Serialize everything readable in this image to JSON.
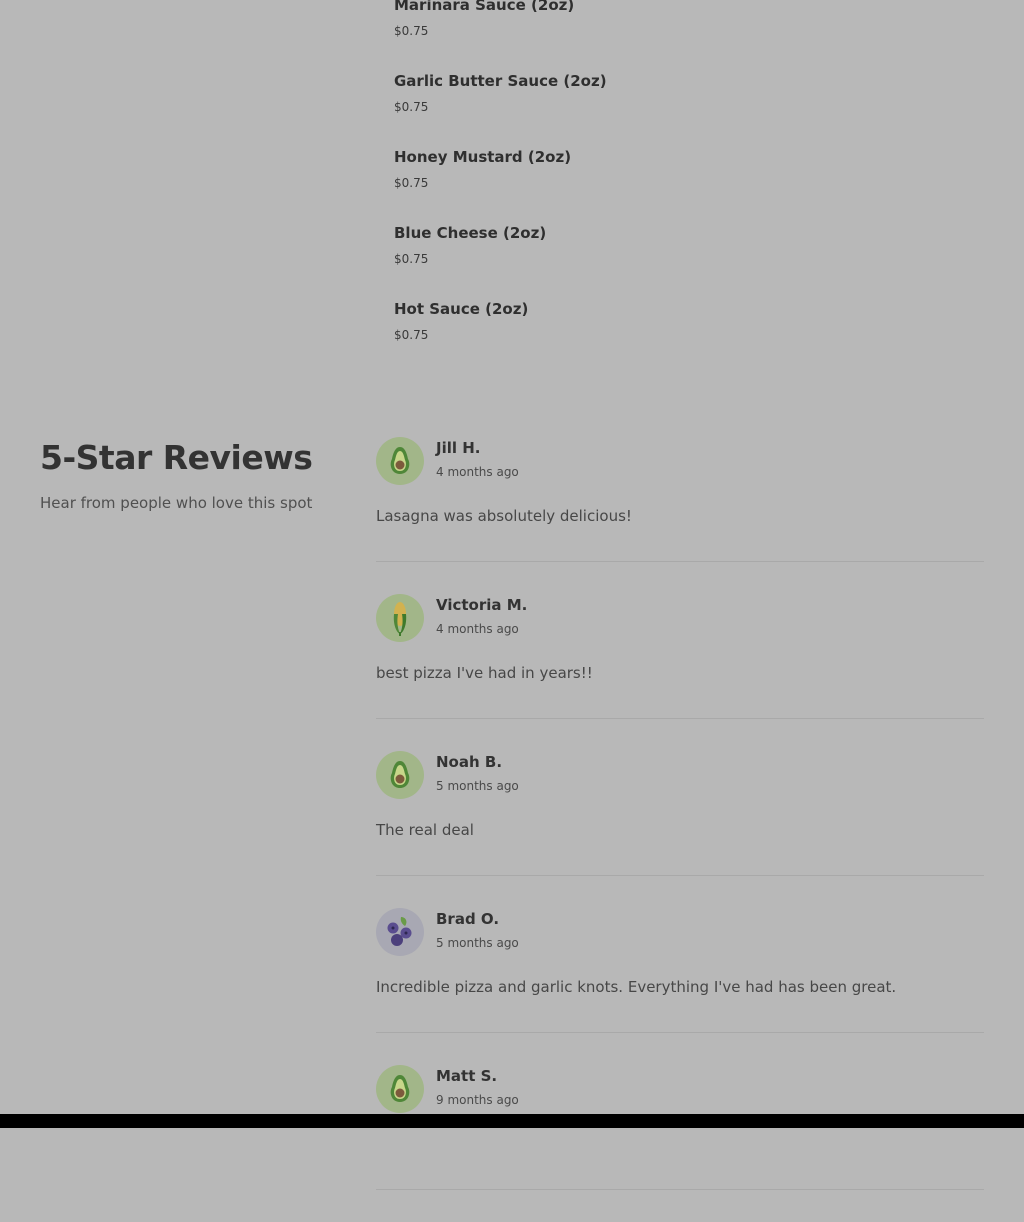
{
  "sauces": [
    {
      "name": "Marinara Sauce (2oz)",
      "price": "$0.75"
    },
    {
      "name": "Garlic Butter Sauce (2oz)",
      "price": "$0.75"
    },
    {
      "name": "Honey Mustard (2oz)",
      "price": "$0.75"
    },
    {
      "name": "Blue Cheese (2oz)",
      "price": "$0.75"
    },
    {
      "name": "Hot Sauce (2oz)",
      "price": "$0.75"
    }
  ],
  "reviews_section": {
    "title": "5-Star Reviews",
    "subtitle": "Hear from people who love this spot"
  },
  "reviews": [
    {
      "name": "Jill H.",
      "time": "4 months ago",
      "text": "Lasagna was absolutely delicious!",
      "avatar": "avocado-icon"
    },
    {
      "name": "Victoria M.",
      "time": "4 months ago",
      "text": "best pizza I've had in years!!",
      "avatar": "corn-icon"
    },
    {
      "name": "Noah B.",
      "time": "5 months ago",
      "text": "The real deal",
      "avatar": "avocado-icon"
    },
    {
      "name": "Brad O.",
      "time": "5 months ago",
      "text": "Incredible pizza and garlic knots. Everything I've had has been great.",
      "avatar": "blueberries-icon"
    },
    {
      "name": "Matt S.",
      "time": "9 months ago",
      "text": "",
      "avatar": "avocado-icon"
    }
  ]
}
